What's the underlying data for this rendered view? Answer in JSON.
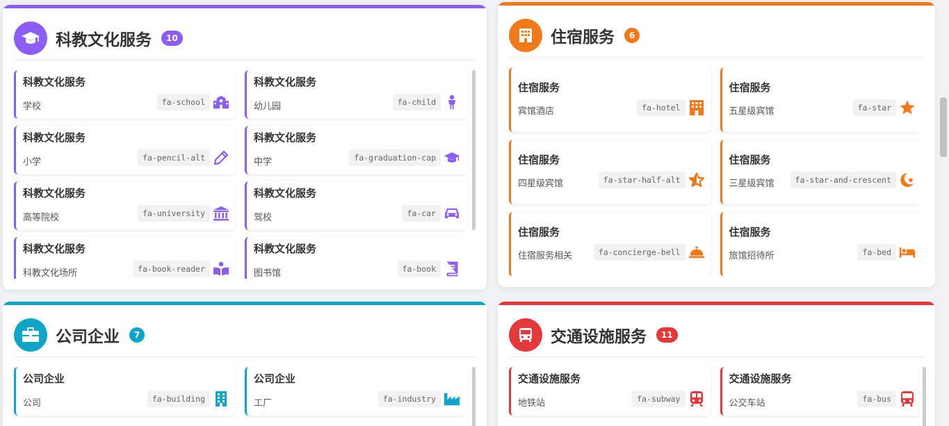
{
  "colors": {
    "purple": "#8b5cf6",
    "orange": "#f07a1a",
    "cyan": "#0ea5c6",
    "red": "#e5383b"
  },
  "panels": {
    "edu": {
      "title": "科教文化服务",
      "count": "10",
      "icon": "graduation-cap-icon",
      "cards": [
        {
          "title": "科教文化服务",
          "sub": "学校",
          "code": "fa-school",
          "icon": "school-icon"
        },
        {
          "title": "科教文化服务",
          "sub": "幼儿园",
          "code": "fa-child",
          "icon": "child-icon"
        },
        {
          "title": "科教文化服务",
          "sub": "小学",
          "code": "fa-pencil-alt",
          "icon": "pencil-icon"
        },
        {
          "title": "科教文化服务",
          "sub": "中学",
          "code": "fa-graduation-cap",
          "icon": "graduation-cap-icon"
        },
        {
          "title": "科教文化服务",
          "sub": "高等院校",
          "code": "fa-university",
          "icon": "university-icon"
        },
        {
          "title": "科教文化服务",
          "sub": "驾校",
          "code": "fa-car",
          "icon": "car-icon"
        },
        {
          "title": "科教文化服务",
          "sub": "科教文化场所",
          "code": "fa-book-reader",
          "icon": "book-reader-icon"
        },
        {
          "title": "科教文化服务",
          "sub": "图书馆",
          "code": "fa-book",
          "icon": "book-icon"
        }
      ]
    },
    "hotel": {
      "title": "住宿服务",
      "count": "6",
      "icon": "hotel-icon",
      "cards": [
        {
          "title": "住宿服务",
          "sub": "宾馆酒店",
          "code": "fa-hotel",
          "icon": "hotel-icon"
        },
        {
          "title": "住宿服务",
          "sub": "五星级宾馆",
          "code": "fa-star",
          "icon": "star-icon"
        },
        {
          "title": "住宿服务",
          "sub": "四星级宾馆",
          "code": "fa-star-half-alt",
          "icon": "star-half-icon"
        },
        {
          "title": "住宿服务",
          "sub": "三星级宾馆",
          "code": "fa-star-and-crescent",
          "icon": "star-and-crescent-icon"
        },
        {
          "title": "住宿服务",
          "sub": "住宿服务相关",
          "code": "fa-concierge-bell",
          "icon": "concierge-bell-icon"
        },
        {
          "title": "住宿服务",
          "sub": "旅馆招待所",
          "code": "fa-bed",
          "icon": "bed-icon"
        }
      ]
    },
    "company": {
      "title": "公司企业",
      "count": "7",
      "icon": "briefcase-icon",
      "cards": [
        {
          "title": "公司企业",
          "sub": "公司",
          "code": "fa-building",
          "icon": "building-icon"
        },
        {
          "title": "公司企业",
          "sub": "工厂",
          "code": "fa-industry",
          "icon": "industry-icon"
        }
      ]
    },
    "transport": {
      "title": "交通设施服务",
      "count": "11",
      "icon": "bus-icon",
      "cards": [
        {
          "title": "交通设施服务",
          "sub": "地铁站",
          "code": "fa-subway",
          "icon": "subway-icon"
        },
        {
          "title": "交通设施服务",
          "sub": "公交车站",
          "code": "fa-bus",
          "icon": "bus-icon"
        }
      ]
    }
  }
}
